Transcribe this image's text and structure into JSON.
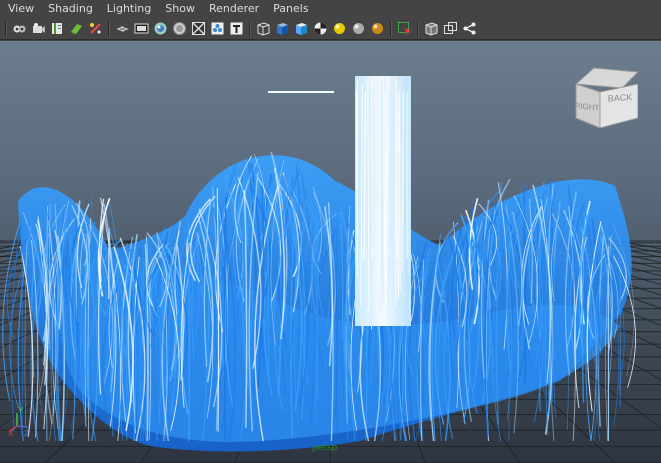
{
  "menu": {
    "items": [
      "View",
      "Shading",
      "Lighting",
      "Show",
      "Renderer",
      "Panels"
    ]
  },
  "toolbar": {
    "icons": [
      "camera-select-icon",
      "camera-attributes-icon",
      "bookmark-icon",
      "image-plane-icon",
      "grease-pencil-icon",
      "grid-icon",
      "film-gate-icon",
      "resolution-gate-icon",
      "gate-mask-icon",
      "field-chart-icon",
      "safe-action-icon",
      "safe-title-icon",
      "wireframe-cube-icon",
      "smooth-shade-icon",
      "flat-shade-icon",
      "checker-icon",
      "default-light-icon",
      "all-lights-icon",
      "use-lights-icon",
      "isolate-select-icon",
      "xray-icon",
      "xray-joints-icon",
      "share-icon"
    ]
  },
  "viewcube": {
    "right_label": "RIGHT",
    "back_label": "BACK"
  },
  "viewport": {
    "camera_label": "persp",
    "axis_labels": {
      "y": "Y",
      "x": "X",
      "z": "Z"
    },
    "colors": {
      "fluid_deep": "#1a78e6",
      "fluid_mid": "#3aa2ff",
      "fluid_light": "#9fd6ff",
      "fluid_white": "#f2fbff",
      "grid_line": "#1c2026",
      "camera_label": "#2a8b2a"
    }
  }
}
